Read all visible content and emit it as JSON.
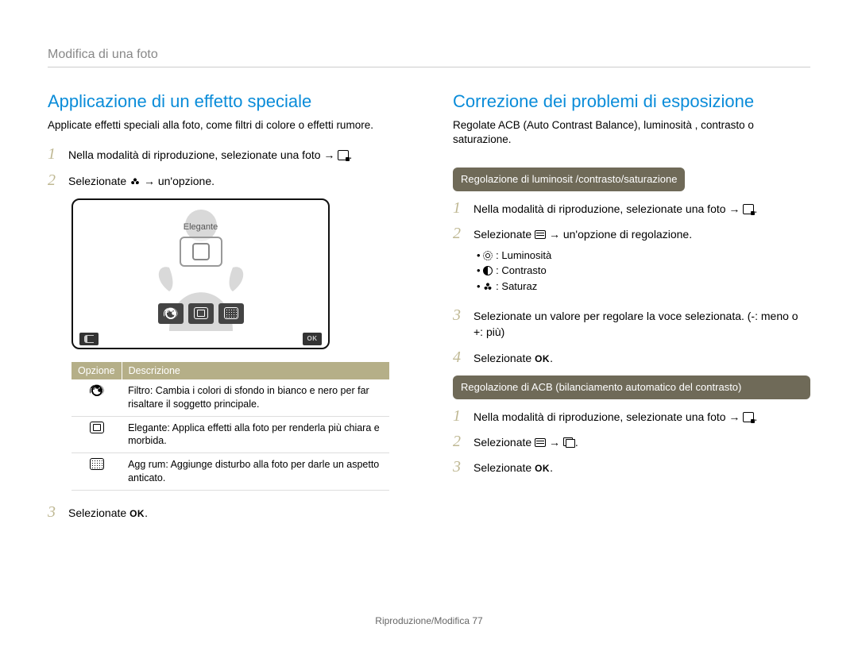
{
  "breadcrumb": "Modifica di una foto",
  "left": {
    "title": "Applicazione di un effetto speciale",
    "lead": "Applicate effetti speciali alla foto, come filtri di colore o effetti rumore.",
    "step1_a": "Nella modalità di riproduzione, selezionate una foto ",
    "step1_b": ".",
    "step2_a": "Selezionate ",
    "step2_b": " un'opzione.",
    "screen_label": "Elegante",
    "screen_ok": "OK",
    "table": {
      "h1": "Opzione",
      "h2": "Descrizione",
      "rows": [
        {
          "label": "Filtro",
          "desc": ": Cambia i colori di sfondo in bianco e nero per far risaltare il soggetto principale."
        },
        {
          "label": "Elegante",
          "desc": ": Applica effetti alla foto per renderla più chiara e morbida."
        },
        {
          "label": "Agg rum",
          "desc": ": Aggiunge disturbo alla foto per darle un aspetto anticato."
        }
      ]
    },
    "step3_a": "Selezionate ",
    "step3_ok": "OK",
    "step3_b": "."
  },
  "right": {
    "title": "Correzione dei problemi di esposizione",
    "lead": "Regolate ACB (Auto Contrast Balance), luminosità , contrasto o saturazione.",
    "tag1": "Regolazione di luminosit  /contrasto/saturazione",
    "r1_step1_a": "Nella modalità di riproduzione, selezionate una foto ",
    "r1_step1_b": ".",
    "r1_step2_a": "Selezionate ",
    "r1_step2_b": " un'opzione di regolazione.",
    "bullets": [
      ": Luminosità",
      ": Contrasto",
      ": Saturaz"
    ],
    "r1_step3": "Selezionate un valore per regolare la voce selezionata. (-: meno o +: più)",
    "r1_step4_a": "Selezionate ",
    "r1_step4_ok": "OK",
    "r1_step4_b": ".",
    "tag2": "Regolazione di ACB (bilanciamento automatico del contrasto)",
    "r2_step1_a": "Nella modalità di riproduzione, selezionate una foto ",
    "r2_step1_b": ".",
    "r2_step2_a": "Selezionate ",
    "r2_step2_b": ".",
    "r2_step3_a": "Selezionate ",
    "r2_step3_ok": "OK",
    "r2_step3_b": "."
  },
  "footer": {
    "section": "Riproduzione/Modifica  ",
    "page": "77"
  }
}
